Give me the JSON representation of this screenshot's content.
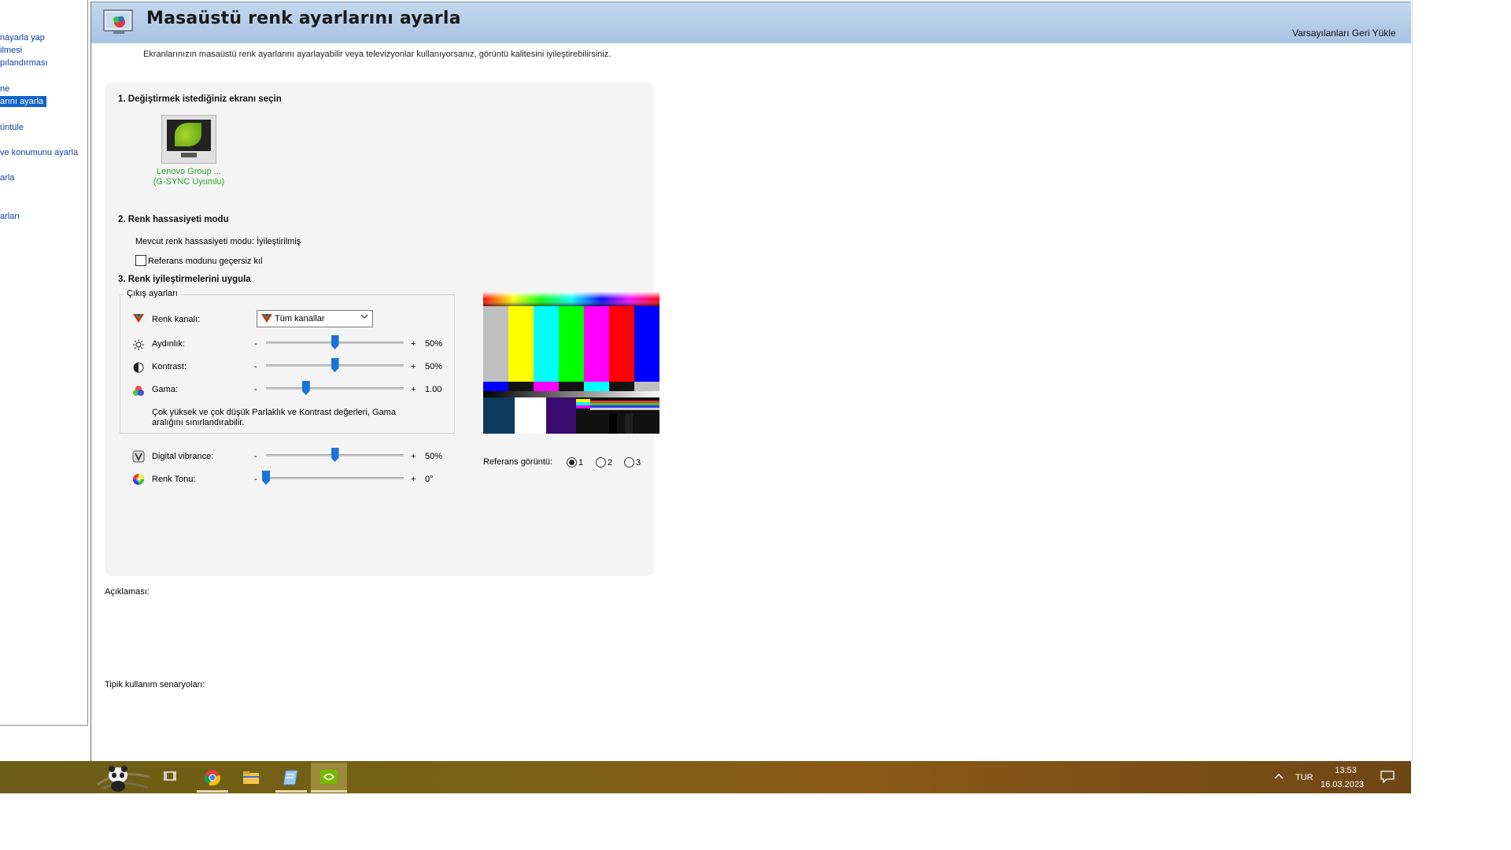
{
  "left_nav": {
    "items": [
      {
        "label": "nayarla yap",
        "selected": false
      },
      {
        "label": "ilmesi",
        "selected": false
      },
      {
        "label": "pılandırması",
        "selected": false
      },
      {
        "label": "ne",
        "selected": false
      },
      {
        "label": "arını ayarla",
        "selected": true
      },
      {
        "label": "üntüle",
        "selected": false
      },
      {
        "label": "ve konumunu ayarla",
        "selected": false
      },
      {
        "label": "arla",
        "selected": false
      },
      {
        "label": "arları",
        "selected": false
      }
    ]
  },
  "header": {
    "title": "Masaüstü renk ayarlarını ayarla",
    "restore_defaults": "Varsayılanları Geri Yükle",
    "icon": "display-color-icon"
  },
  "description": "Ekranlarınızın masaüstü renk ayarlarını ayarlayabilir veya televizyonlar kullanıyorsanız, görüntü kalitesini iyileştirebilirsiniz.",
  "section1": {
    "title": "1. Değiştirmek istediğiniz ekranı seçin",
    "display_name": "Lenovo Group ...",
    "display_sub": "(G-SYNC Uyumlu)"
  },
  "section2": {
    "title": "2. Renk hassasiyeti modu",
    "current_mode": "Mevcut renk hassasiyeti modu: İyileştirilmiş",
    "override_checkbox": "Referans modunu geçersiz kıl",
    "override_checked": false
  },
  "section3": {
    "title": "3. Renk iyileştirmelerini uygula",
    "group_label": "Çıkış ayarları",
    "channel_label": "Renk kanalı:",
    "channel_value": "Tüm kanallar",
    "brightness": {
      "label": "Aydınlık:",
      "minus": "-",
      "plus": "+",
      "value": "50%",
      "level": 0.5
    },
    "contrast": {
      "label": "Kontrast:",
      "minus": "-",
      "plus": "+",
      "value": "50%",
      "level": 0.5
    },
    "gamma": {
      "label": "Gama:",
      "minus": "-",
      "plus": "+",
      "value": "1.00",
      "level": 0.29
    },
    "warning": "Çok yüksek ve çok düşük Parlaklık ve Kontrast değerleri, Gama aralığını sınırlandırabilir.",
    "vibrance": {
      "label": "Digital vibrance:",
      "minus": "-",
      "plus": "+",
      "value": "50%",
      "level": 0.5
    },
    "hue": {
      "label": "Renk Tonu:",
      "minus": "-",
      "plus": "+",
      "value": "0°",
      "level": 0.0
    }
  },
  "reference": {
    "label": "Referans görüntü:",
    "options": [
      "1",
      "2",
      "3"
    ],
    "selected": "1"
  },
  "explanation_label": "Açıklaması:",
  "scenarios_label": "Tipik kullanım senaryoları:",
  "taskbar": {
    "apps": [
      "panda-start-icon",
      "task-view-icon",
      "chrome-icon",
      "file-explorer-icon",
      "notepad-icon",
      "nvidia-icon"
    ],
    "language": "TUR",
    "time": "13:53",
    "date": "16.03.2023"
  },
  "colors": {
    "link_blue": "#0a3fa8",
    "selection_blue": "#0f63c9",
    "slider_blue": "#1a73d6",
    "green_text": "#2ea52e"
  }
}
